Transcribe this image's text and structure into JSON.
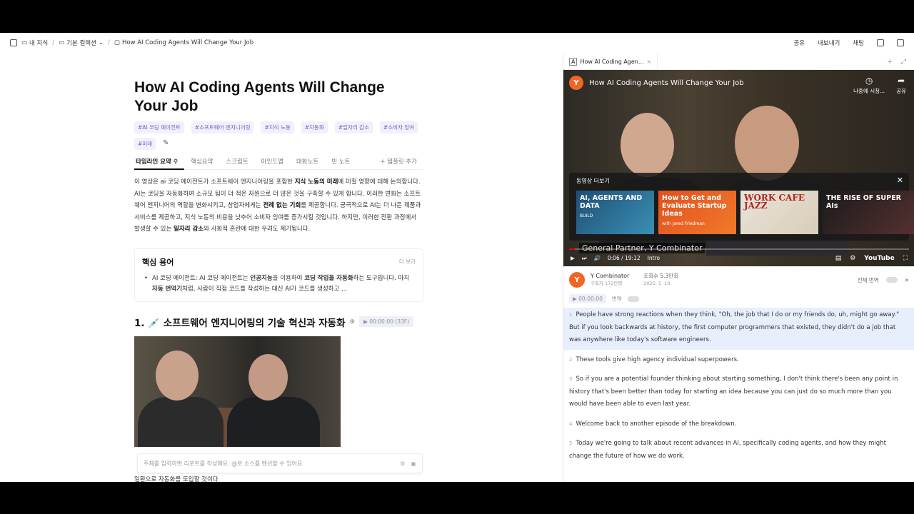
{
  "topbar": {
    "crumbs": [
      "내 지식",
      "기본 컬렉션",
      "How AI Coding Agents Will Change Your Job"
    ],
    "actions": [
      "공유",
      "내보내기",
      "채팅"
    ]
  },
  "doc": {
    "title_line1": "How AI Coding Agents Will Change",
    "title_line2": "Your Job",
    "tags": [
      "#AI 코딩 에이전트",
      "#소프트웨어 엔지니어링",
      "#지식 노동",
      "#자동화",
      "#일자리 감소",
      "#소비자 잉여",
      "#미래"
    ],
    "tabs": [
      "타임라인 요약",
      "핵심요약",
      "스크립트",
      "마인드맵",
      "대화노트",
      "빈 노트"
    ],
    "tab_add": "+ 템플릿 추가",
    "summary": {
      "p1": "이 영상은 ai 코딩 에이전트가 소프트웨어 엔지니어링을 포함한 ",
      "b1": "지식 노동의 미래",
      "p2": "에 미칠 영향에 대해 논의합니다. AI는 코딩을 자동화하여 소규모 팀이 더 적은 자원으로 더 많은 것을 구축할 수 있게 합니다. 이러한 변화는 소프트웨어 엔지니어의 역할을 변화시키고, 창업자에게는 ",
      "b2": "전례 없는 기회",
      "p3": "를 제공합니다. 궁극적으로 AI는 더 나은 제품과 서비스를 제공하고, 지식 노동의 비용을 낮추어 소비자 잉여를 증가시킬 것입니다. 하지만, 이러한 전환 과정에서 발생할 수 있는 ",
      "b3": "일자리 감소",
      "p4": "와 사회적 혼란에 대한 우려도 제기됩니다."
    },
    "terms": {
      "title": "핵심 용어",
      "more": "더 보기",
      "item_a": "AI 코딩 에이전트: AI 코딩 에이전트는 ",
      "item_b": "인공지능",
      "item_c": "을 이용하여 ",
      "item_d": "코딩 작업을 자동화",
      "item_e": "하는 도구입니다. 마치 ",
      "item_f": "자동 번역기",
      "item_g": "처럼, 사람이 직접 코드를 작성하는 대신 AI가 코드를 생성하고 ..."
    },
    "section": {
      "title": "1. 💉 소프트웨어 엔지니어링의 기술 혁신과 자동화",
      "timestamp": "▶ 00:00:00 (33F)"
    },
    "prompt_placeholder": "주제를 입력하면 리포트를 작성해요. @로 소스를 멘션할 수 있어요",
    "bottom_text": "일환으로 자동화를 도입할 것이다"
  },
  "right": {
    "tab_label": "How AI Coding Agen...",
    "video": {
      "title": "How AI Coding Agents Will Change Your Job",
      "watch_later": "나중에 시청...",
      "share": "공유",
      "more_videos": "동영상 더보기",
      "cards": [
        {
          "title": "AI, AGENTS AND DATA",
          "sub": "BUILD"
        },
        {
          "title": "How to Get and Evaluate Startup Ideas",
          "sub": "with Jared Friedman"
        },
        {
          "title": "WORK CAFE JAZZ",
          "sub": ""
        },
        {
          "title": "THE RISE OF SUPER AIs",
          "sub": ""
        }
      ],
      "caption": "General Partner, Y Combinator",
      "time": "0:06 / 19:12",
      "chapter": "Intro",
      "brand": "YouTube"
    },
    "channel": {
      "name": "Y Combinator",
      "subs": "구독자 172만명",
      "views": "조회수 5.3만회",
      "date": "2025. 5. 10.",
      "translate": "전체 번역"
    },
    "transcript_ctrl": {
      "time": "▶ 00:00:00",
      "label": "번역"
    },
    "transcript": [
      {
        "n": "1",
        "text": "People have strong reactions when they think, \"Oh, the job that I do or my friends do, uh, might go away.\" But if you look backwards at history, the first computer programmers that existed, they didn't do a job that was anywhere like today's software engineers."
      },
      {
        "n": "2",
        "text": "These tools give high agency individual superpowers."
      },
      {
        "n": "3",
        "text": "So if you are a potential founder thinking about starting something, I don't think there's been any point in history that's been better than today for starting an idea because you can just do so much more than you would have been able to even last year."
      },
      {
        "n": "4",
        "text": "Welcome back to another episode of the breakdown."
      },
      {
        "n": "5",
        "text": "Today we're going to talk about recent advances in AI, specifically coding agents, and how they might change the future of how we do work."
      }
    ]
  }
}
